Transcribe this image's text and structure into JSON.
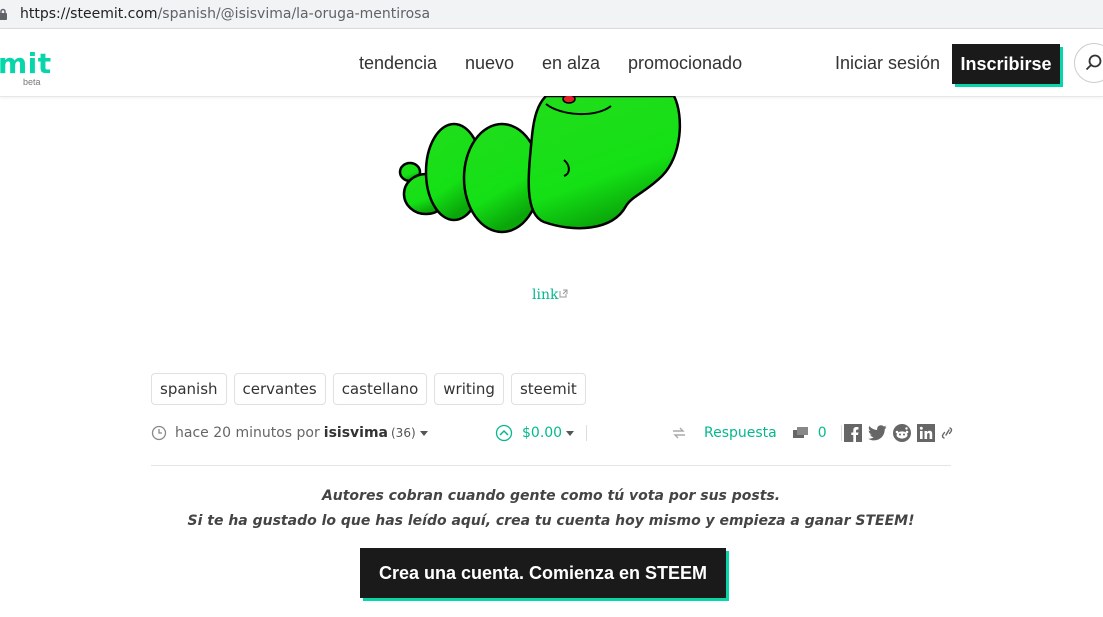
{
  "browser": {
    "url_host": "https://steemit.com",
    "url_path": "/spanish/@isisvima/la-oruga-mentirosa"
  },
  "header": {
    "logo_text": "mit",
    "logo_badge": "beta",
    "nav": [
      "tendencia",
      "nuevo",
      "en alza",
      "promocionado"
    ],
    "login_label": "Iniciar sesión",
    "signup_label": "Inscribirse",
    "brand_color": "#06d6a9"
  },
  "post": {
    "image_icon": "green-caterpillar-image",
    "link_label": "link",
    "tags": [
      "spanish",
      "cervantes",
      "castellano",
      "writing",
      "steemit"
    ],
    "time_ago": "hace 20 minutos por",
    "author": "isisvima",
    "reputation": "(36)",
    "payout": "$0.00",
    "reply_label": "Respuesta",
    "comment_count": "0"
  },
  "cta": {
    "line1": "Autores cobran cuando gente como tú vota por sus posts.",
    "line2": "Si te ha gustado lo que has leído aquí, crea tu cuenta hoy mismo y empieza a ganar STEEM!",
    "button_label": "Crea una cuenta. Comienza en STEEM"
  }
}
